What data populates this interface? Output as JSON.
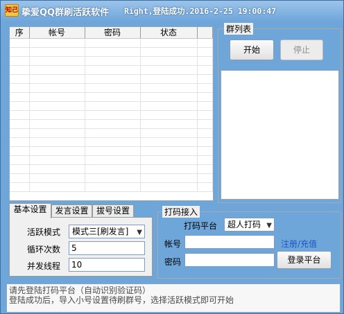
{
  "window": {
    "app_icon_text": "知己",
    "title": "挚爱QQ群刷活跃软件",
    "status": "Right,登陆成功.2016-2-25 19:00:47"
  },
  "accounts_table": {
    "columns": [
      "序",
      "帐号",
      "密码",
      "状态"
    ],
    "rows": []
  },
  "group_list": {
    "title": "群列表",
    "start_label": "开始",
    "stop_label": "停止",
    "items": []
  },
  "tabs": [
    {
      "label": "基本设置",
      "active": true
    },
    {
      "label": "发言设置",
      "active": false
    },
    {
      "label": "拔号设置",
      "active": false
    }
  ],
  "basic_settings": {
    "mode_label": "活跃模式",
    "mode_value": "模式三[刷发言]",
    "loop_label": "循环次数",
    "loop_value": "5",
    "threads_label": "并发线程",
    "threads_value": "10"
  },
  "captcha": {
    "title": "打码接入",
    "platform_label": "打码平台",
    "platform_value": "超人打码",
    "account_label": "帐号",
    "account_value": "",
    "password_label": "密码",
    "password_value": "",
    "register_link": "注册/充值",
    "login_label": "登录平台"
  },
  "log": {
    "lines": [
      "请先登陆打码平台（自动识别验证码）",
      "登陆成功后，导入小号设置待刷群号，选择活跃模式即可开始"
    ]
  }
}
